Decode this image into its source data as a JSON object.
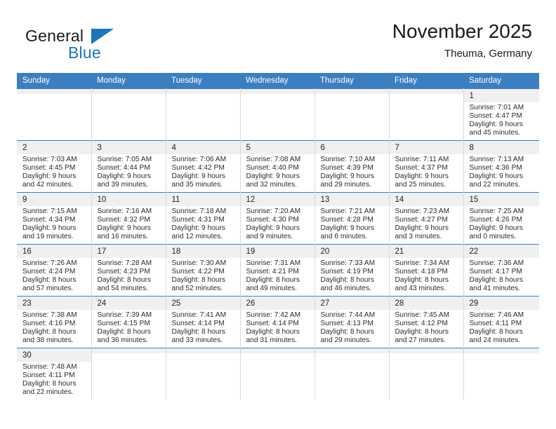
{
  "brand": {
    "general": "General",
    "blue": "Blue",
    "flag_icon": "brand-flag-icon"
  },
  "header": {
    "month_title": "November 2025",
    "location": "Theuma, Germany"
  },
  "colors": {
    "header_blue": "#3c7fc1",
    "brand_blue": "#1b75bb",
    "daynum_bg": "#f0f0f0",
    "grid_line": "#d8d8d8"
  },
  "weekdays": [
    "Sunday",
    "Monday",
    "Tuesday",
    "Wednesday",
    "Thursday",
    "Friday",
    "Saturday"
  ],
  "days": {
    "d1": {
      "num": "1",
      "sunrise": "Sunrise: 7:01 AM",
      "sunset": "Sunset: 4:47 PM",
      "daylight1": "Daylight: 9 hours",
      "daylight2": "and 45 minutes."
    },
    "d2": {
      "num": "2",
      "sunrise": "Sunrise: 7:03 AM",
      "sunset": "Sunset: 4:45 PM",
      "daylight1": "Daylight: 9 hours",
      "daylight2": "and 42 minutes."
    },
    "d3": {
      "num": "3",
      "sunrise": "Sunrise: 7:05 AM",
      "sunset": "Sunset: 4:44 PM",
      "daylight1": "Daylight: 9 hours",
      "daylight2": "and 39 minutes."
    },
    "d4": {
      "num": "4",
      "sunrise": "Sunrise: 7:06 AM",
      "sunset": "Sunset: 4:42 PM",
      "daylight1": "Daylight: 9 hours",
      "daylight2": "and 35 minutes."
    },
    "d5": {
      "num": "5",
      "sunrise": "Sunrise: 7:08 AM",
      "sunset": "Sunset: 4:40 PM",
      "daylight1": "Daylight: 9 hours",
      "daylight2": "and 32 minutes."
    },
    "d6": {
      "num": "6",
      "sunrise": "Sunrise: 7:10 AM",
      "sunset": "Sunset: 4:39 PM",
      "daylight1": "Daylight: 9 hours",
      "daylight2": "and 29 minutes."
    },
    "d7": {
      "num": "7",
      "sunrise": "Sunrise: 7:11 AM",
      "sunset": "Sunset: 4:37 PM",
      "daylight1": "Daylight: 9 hours",
      "daylight2": "and 25 minutes."
    },
    "d8": {
      "num": "8",
      "sunrise": "Sunrise: 7:13 AM",
      "sunset": "Sunset: 4:36 PM",
      "daylight1": "Daylight: 9 hours",
      "daylight2": "and 22 minutes."
    },
    "d9": {
      "num": "9",
      "sunrise": "Sunrise: 7:15 AM",
      "sunset": "Sunset: 4:34 PM",
      "daylight1": "Daylight: 9 hours",
      "daylight2": "and 19 minutes."
    },
    "d10": {
      "num": "10",
      "sunrise": "Sunrise: 7:16 AM",
      "sunset": "Sunset: 4:32 PM",
      "daylight1": "Daylight: 9 hours",
      "daylight2": "and 16 minutes."
    },
    "d11": {
      "num": "11",
      "sunrise": "Sunrise: 7:18 AM",
      "sunset": "Sunset: 4:31 PM",
      "daylight1": "Daylight: 9 hours",
      "daylight2": "and 12 minutes."
    },
    "d12": {
      "num": "12",
      "sunrise": "Sunrise: 7:20 AM",
      "sunset": "Sunset: 4:30 PM",
      "daylight1": "Daylight: 9 hours",
      "daylight2": "and 9 minutes."
    },
    "d13": {
      "num": "13",
      "sunrise": "Sunrise: 7:21 AM",
      "sunset": "Sunset: 4:28 PM",
      "daylight1": "Daylight: 9 hours",
      "daylight2": "and 6 minutes."
    },
    "d14": {
      "num": "14",
      "sunrise": "Sunrise: 7:23 AM",
      "sunset": "Sunset: 4:27 PM",
      "daylight1": "Daylight: 9 hours",
      "daylight2": "and 3 minutes."
    },
    "d15": {
      "num": "15",
      "sunrise": "Sunrise: 7:25 AM",
      "sunset": "Sunset: 4:26 PM",
      "daylight1": "Daylight: 9 hours",
      "daylight2": "and 0 minutes."
    },
    "d16": {
      "num": "16",
      "sunrise": "Sunrise: 7:26 AM",
      "sunset": "Sunset: 4:24 PM",
      "daylight1": "Daylight: 8 hours",
      "daylight2": "and 57 minutes."
    },
    "d17": {
      "num": "17",
      "sunrise": "Sunrise: 7:28 AM",
      "sunset": "Sunset: 4:23 PM",
      "daylight1": "Daylight: 8 hours",
      "daylight2": "and 54 minutes."
    },
    "d18": {
      "num": "18",
      "sunrise": "Sunrise: 7:30 AM",
      "sunset": "Sunset: 4:22 PM",
      "daylight1": "Daylight: 8 hours",
      "daylight2": "and 52 minutes."
    },
    "d19": {
      "num": "19",
      "sunrise": "Sunrise: 7:31 AM",
      "sunset": "Sunset: 4:21 PM",
      "daylight1": "Daylight: 8 hours",
      "daylight2": "and 49 minutes."
    },
    "d20": {
      "num": "20",
      "sunrise": "Sunrise: 7:33 AM",
      "sunset": "Sunset: 4:19 PM",
      "daylight1": "Daylight: 8 hours",
      "daylight2": "and 46 minutes."
    },
    "d21": {
      "num": "21",
      "sunrise": "Sunrise: 7:34 AM",
      "sunset": "Sunset: 4:18 PM",
      "daylight1": "Daylight: 8 hours",
      "daylight2": "and 43 minutes."
    },
    "d22": {
      "num": "22",
      "sunrise": "Sunrise: 7:36 AM",
      "sunset": "Sunset: 4:17 PM",
      "daylight1": "Daylight: 8 hours",
      "daylight2": "and 41 minutes."
    },
    "d23": {
      "num": "23",
      "sunrise": "Sunrise: 7:38 AM",
      "sunset": "Sunset: 4:16 PM",
      "daylight1": "Daylight: 8 hours",
      "daylight2": "and 38 minutes."
    },
    "d24": {
      "num": "24",
      "sunrise": "Sunrise: 7:39 AM",
      "sunset": "Sunset: 4:15 PM",
      "daylight1": "Daylight: 8 hours",
      "daylight2": "and 36 minutes."
    },
    "d25": {
      "num": "25",
      "sunrise": "Sunrise: 7:41 AM",
      "sunset": "Sunset: 4:14 PM",
      "daylight1": "Daylight: 8 hours",
      "daylight2": "and 33 minutes."
    },
    "d26": {
      "num": "26",
      "sunrise": "Sunrise: 7:42 AM",
      "sunset": "Sunset: 4:14 PM",
      "daylight1": "Daylight: 8 hours",
      "daylight2": "and 31 minutes."
    },
    "d27": {
      "num": "27",
      "sunrise": "Sunrise: 7:44 AM",
      "sunset": "Sunset: 4:13 PM",
      "daylight1": "Daylight: 8 hours",
      "daylight2": "and 29 minutes."
    },
    "d28": {
      "num": "28",
      "sunrise": "Sunrise: 7:45 AM",
      "sunset": "Sunset: 4:12 PM",
      "daylight1": "Daylight: 8 hours",
      "daylight2": "and 27 minutes."
    },
    "d29": {
      "num": "29",
      "sunrise": "Sunrise: 7:46 AM",
      "sunset": "Sunset: 4:11 PM",
      "daylight1": "Daylight: 8 hours",
      "daylight2": "and 24 minutes."
    },
    "d30": {
      "num": "30",
      "sunrise": "Sunrise: 7:48 AM",
      "sunset": "Sunset: 4:11 PM",
      "daylight1": "Daylight: 8 hours",
      "daylight2": "and 22 minutes."
    }
  }
}
